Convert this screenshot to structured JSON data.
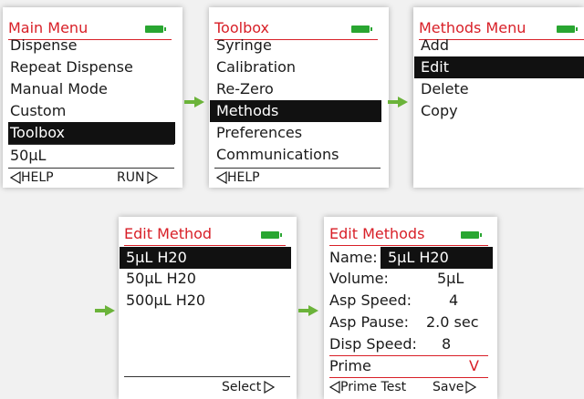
{
  "colors": {
    "accent": "#d81f27",
    "battery": "#29a631",
    "arrow": "#6bb33a",
    "selection": "#111111"
  },
  "main_menu": {
    "title": "Main Menu",
    "items": [
      "Dispense",
      "Repeat Dispense",
      "Manual Mode",
      "Custom",
      "Toolbox"
    ],
    "selected": "Toolbox",
    "volume": "50µL",
    "help_label": "HELP",
    "run_label": "RUN"
  },
  "toolbox": {
    "title": "Toolbox",
    "items": [
      "Syringe",
      "Calibration",
      "Re-Zero",
      "Methods",
      "Preferences",
      "Communications"
    ],
    "selected": "Methods",
    "help_label": "HELP"
  },
  "methods_menu": {
    "title": "Methods Menu",
    "items": [
      "Add",
      "Edit",
      "Delete",
      "Copy"
    ],
    "selected": "Edit"
  },
  "edit_method": {
    "title": "Edit Method",
    "items": [
      "5µL H20",
      "50µL H20",
      "500µL H20"
    ],
    "selected": "5µL H20",
    "select_label": "Select"
  },
  "edit_methods": {
    "title": "Edit Methods",
    "name_label": "Name:",
    "name_value": "5µL H20",
    "volume_label": "Volume:",
    "volume_value": "5µL",
    "asp_speed_label": "Asp Speed:",
    "asp_speed_value": "4",
    "asp_pause_label": "Asp Pause:",
    "asp_pause_value": "2.0 sec",
    "disp_speed_label": "Disp Speed:",
    "disp_speed_value": "8",
    "prime_label": "Prime",
    "prime_value": "V",
    "prime_test_label": "Prime Test",
    "save_label": "Save"
  }
}
